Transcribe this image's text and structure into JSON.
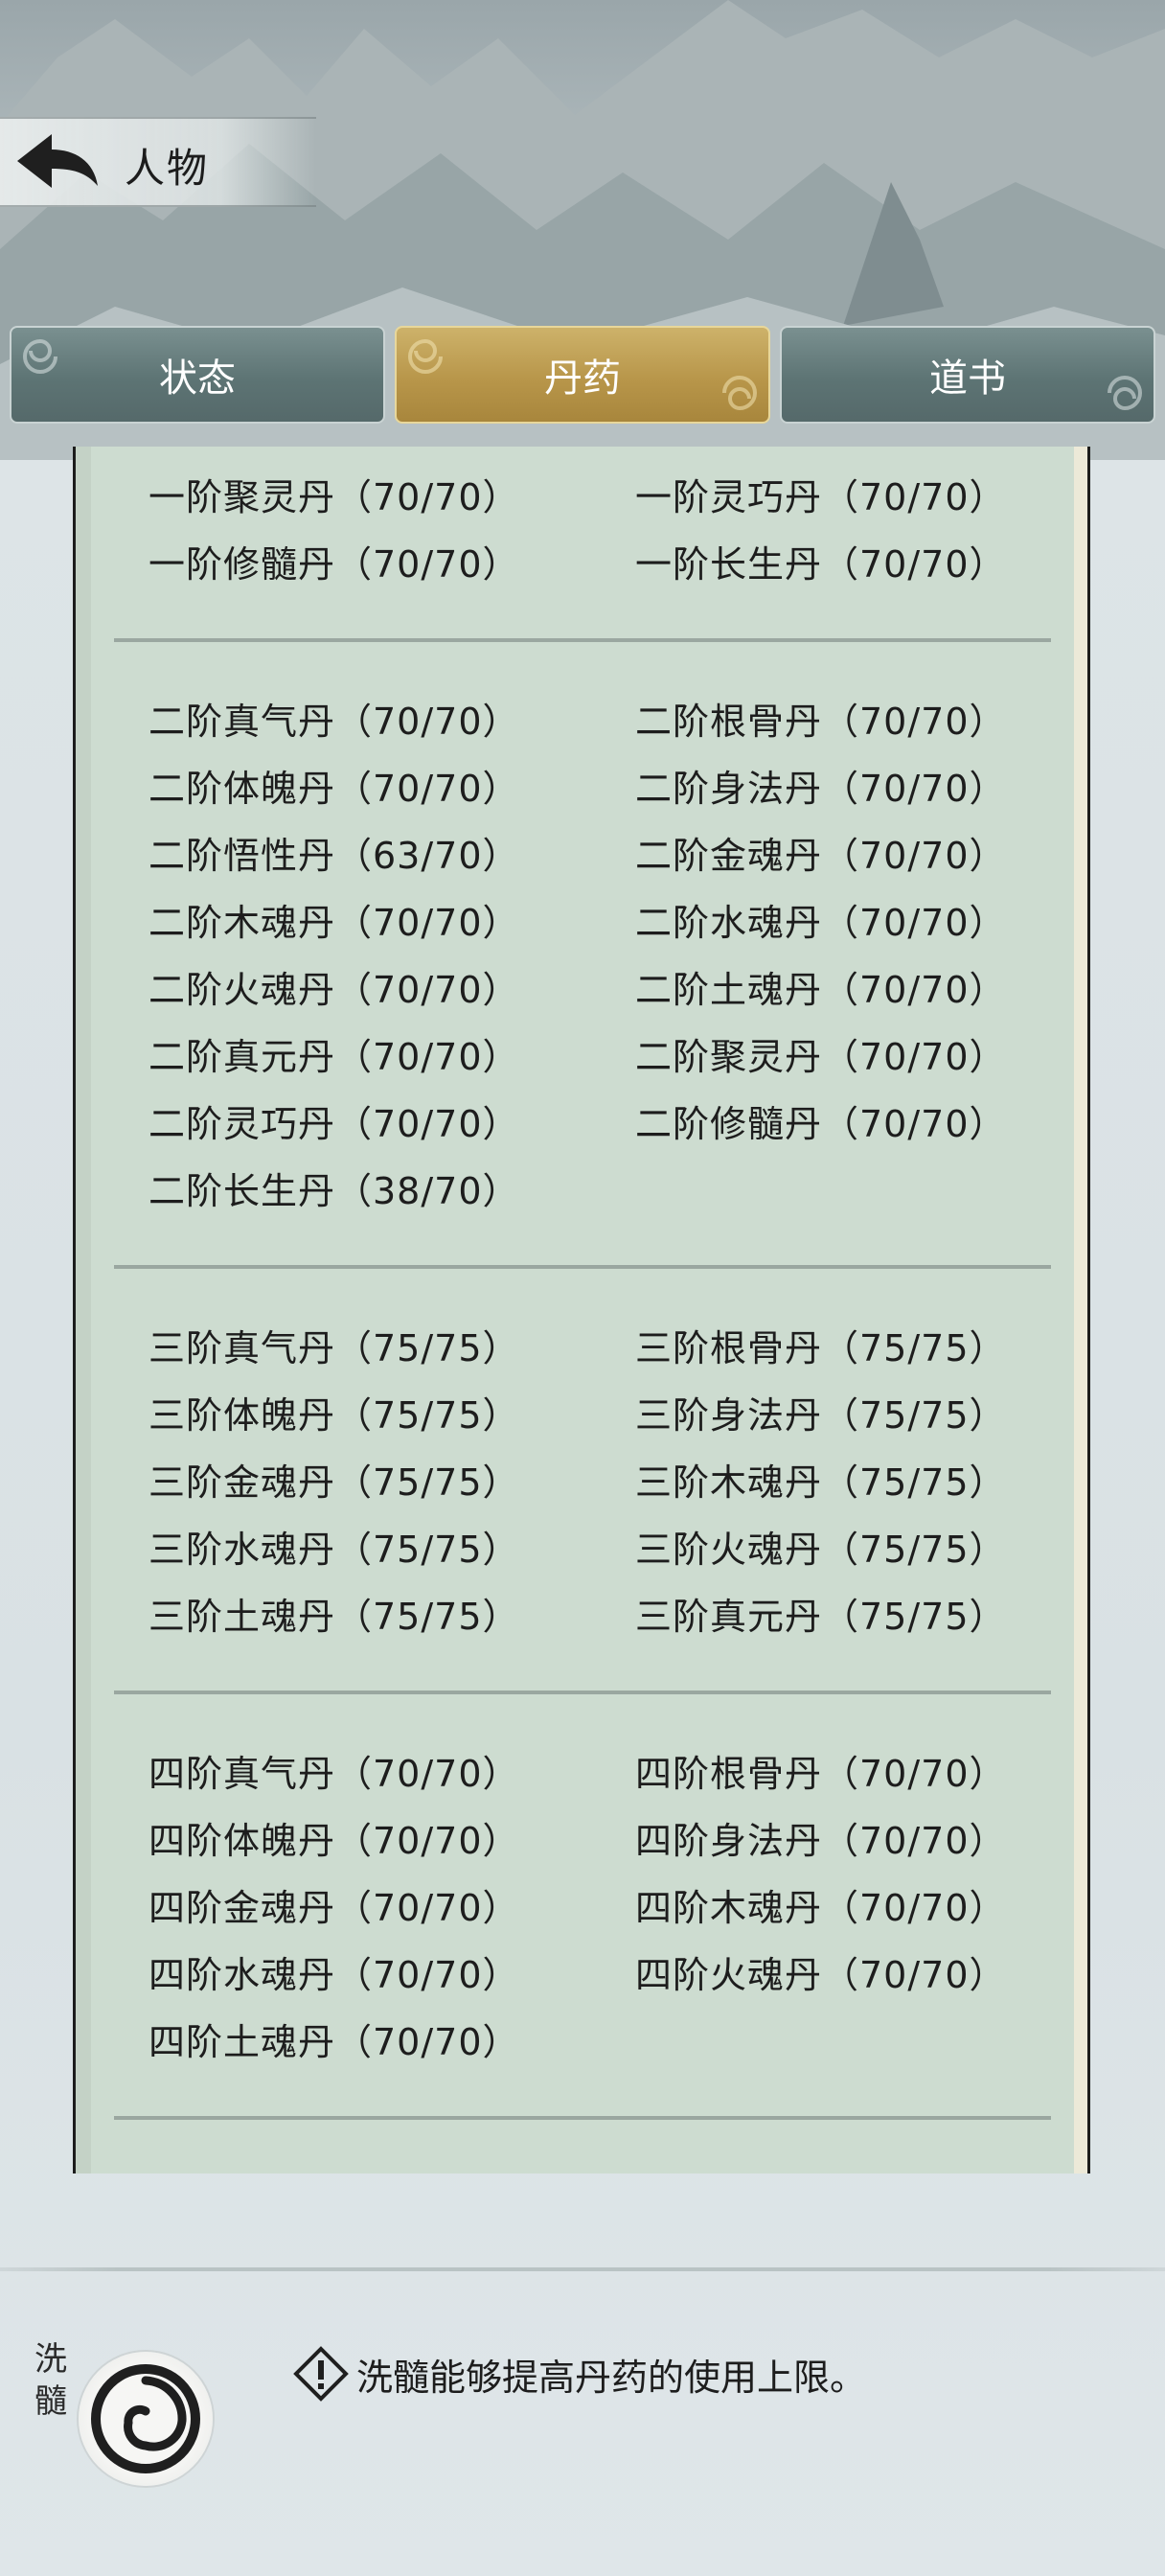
{
  "header": {
    "title": "人物"
  },
  "tabs": [
    {
      "label": "状态",
      "active": false
    },
    {
      "label": "丹药",
      "active": true
    },
    {
      "label": "道书",
      "active": false
    }
  ],
  "groups": [
    {
      "items": [
        "一阶聚灵丹（70/70）",
        "一阶灵巧丹（70/70）",
        "一阶修髓丹（70/70）",
        "一阶长生丹（70/70）"
      ]
    },
    {
      "items": [
        "二阶真气丹（70/70）",
        "二阶根骨丹（70/70）",
        "二阶体魄丹（70/70）",
        "二阶身法丹（70/70）",
        "二阶悟性丹（63/70）",
        "二阶金魂丹（70/70）",
        "二阶木魂丹（70/70）",
        "二阶水魂丹（70/70）",
        "二阶火魂丹（70/70）",
        "二阶土魂丹（70/70）",
        "二阶真元丹（70/70）",
        "二阶聚灵丹（70/70）",
        "二阶灵巧丹（70/70）",
        "二阶修髓丹（70/70）",
        "二阶长生丹（38/70）"
      ]
    },
    {
      "items": [
        "三阶真气丹（75/75）",
        "三阶根骨丹（75/75）",
        "三阶体魄丹（75/75）",
        "三阶身法丹（75/75）",
        "三阶金魂丹（75/75）",
        "三阶木魂丹（75/75）",
        "三阶水魂丹（75/75）",
        "三阶火魂丹（75/75）",
        "三阶土魂丹（75/75）",
        "三阶真元丹（75/75）"
      ]
    },
    {
      "items": [
        "四阶真气丹（70/70）",
        "四阶根骨丹（70/70）",
        "四阶体魄丹（70/70）",
        "四阶身法丹（70/70）",
        "四阶金魂丹（70/70）",
        "四阶木魂丹（70/70）",
        "四阶水魂丹（70/70）",
        "四阶火魂丹（70/70）",
        "四阶土魂丹（70/70）"
      ]
    }
  ],
  "footer": {
    "xisui_label": "洗髓",
    "hint": "洗髓能够提高丹药的使用上限。"
  },
  "colors": {
    "tab_active": "#b8964a",
    "tab_inactive": "#5d7474",
    "panel_bg": "#cddcd0"
  }
}
